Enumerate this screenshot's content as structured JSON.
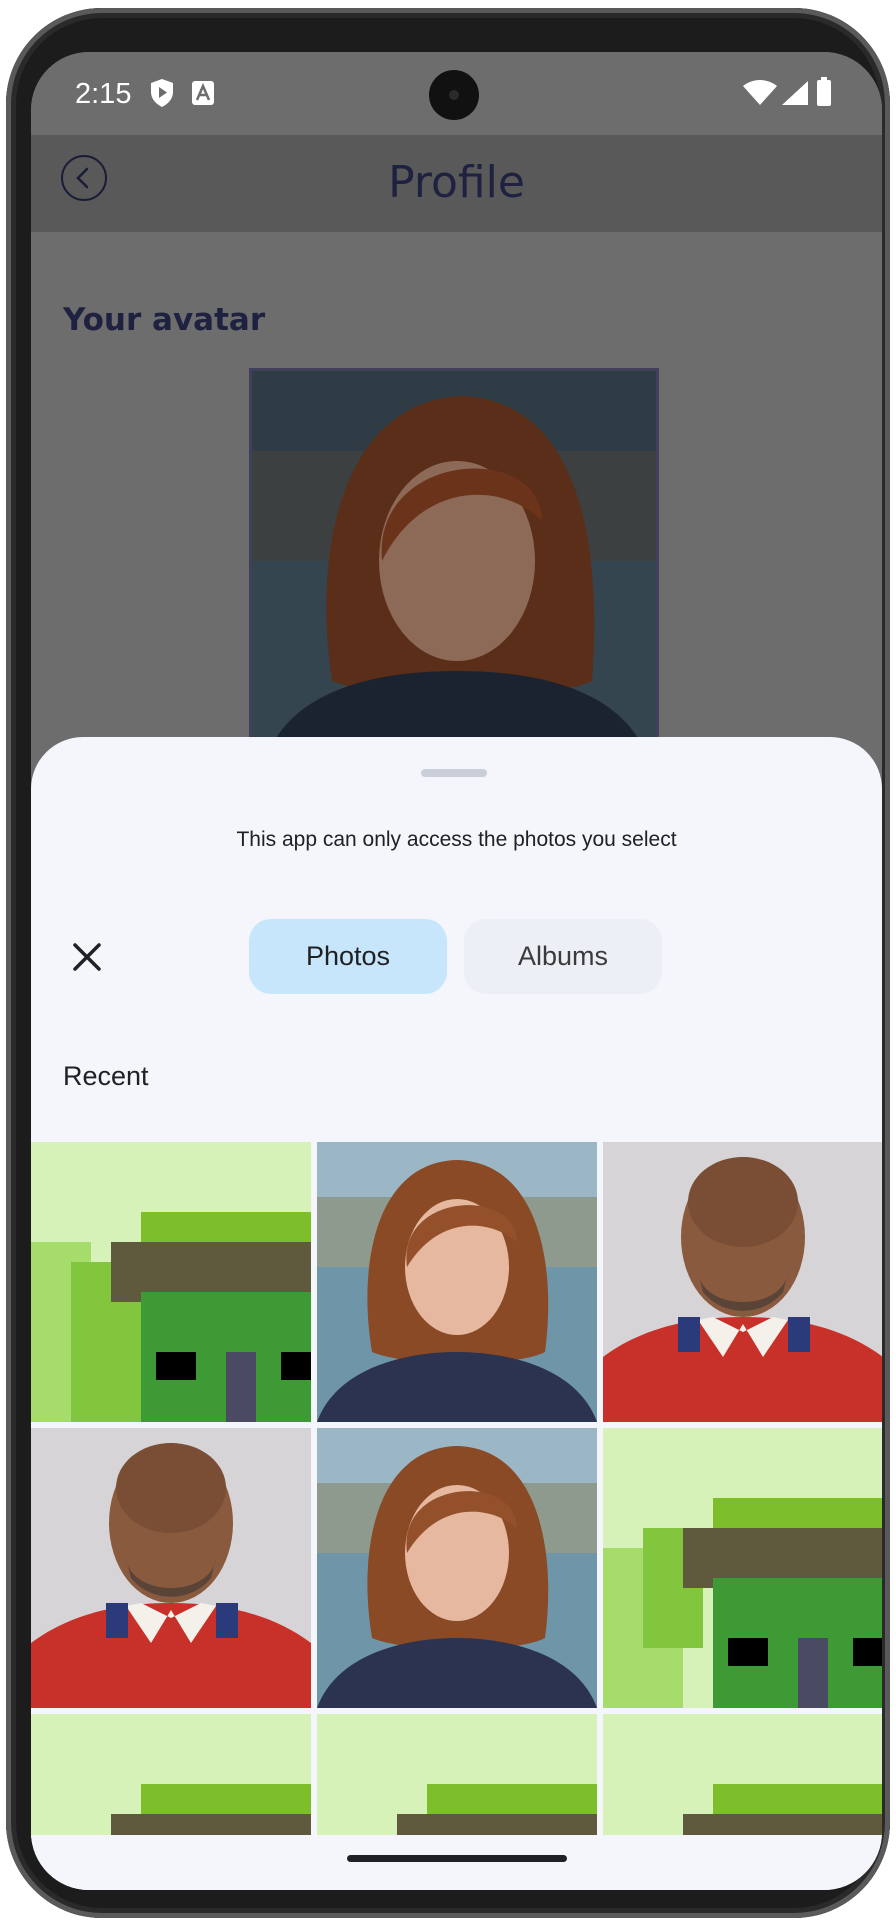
{
  "status_bar": {
    "time": "2:15",
    "icons": [
      "shield-play-icon",
      "accessibility-icon",
      "wifi-icon",
      "signal-icon",
      "battery-icon"
    ]
  },
  "app_bar": {
    "title": "Profile",
    "back_icon": "back-arrow-icon"
  },
  "profile": {
    "section_heading": "Your avatar"
  },
  "picker": {
    "notice": "This app can only access the photos you select",
    "close_icon": "close-icon",
    "tabs": [
      {
        "label": "Photos",
        "selected": true
      },
      {
        "label": "Albums",
        "selected": false
      }
    ],
    "section_label": "Recent",
    "photos": [
      {
        "kind": "pixel-house"
      },
      {
        "kind": "portrait-woman"
      },
      {
        "kind": "portrait-man"
      },
      {
        "kind": "portrait-man"
      },
      {
        "kind": "portrait-woman"
      },
      {
        "kind": "pixel-house"
      },
      {
        "kind": "pixel-house"
      },
      {
        "kind": "pixel-house"
      },
      {
        "kind": "pixel-house"
      }
    ]
  },
  "colors": {
    "scrim": "#6d6d6d",
    "sheet": "#f4f6fc",
    "tab_selected": "#c8e6fb",
    "tab_unselected": "#eceff5",
    "title_text": "#1f2140"
  }
}
